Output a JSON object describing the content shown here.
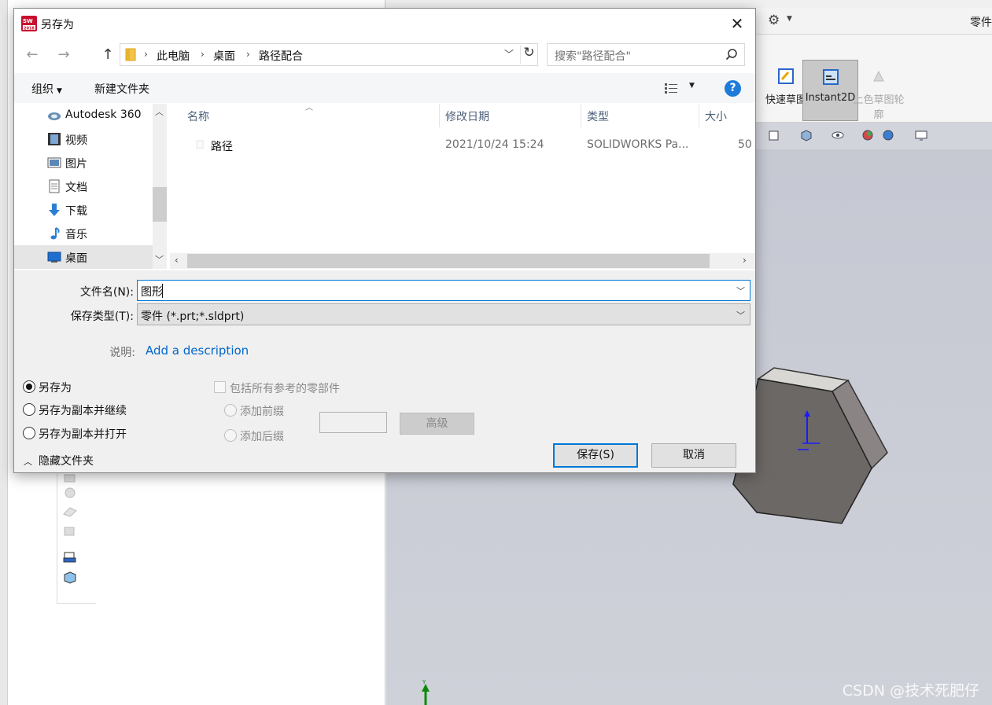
{
  "background_app": {
    "part_label": "零件",
    "ribbon": {
      "quick_sketch": "快速草图",
      "instant2d": "Instant2D",
      "shaded_sketch": "上色草图轮廓"
    },
    "watermark": "CSDN @技术死肥仔"
  },
  "dialog": {
    "title": "另存为",
    "address": {
      "crumbs": [
        "此电脑",
        "桌面",
        "路径配合"
      ]
    },
    "search": {
      "placeholder": "搜索\"路径配合\""
    },
    "commands": {
      "organize": "组织",
      "new_folder": "新建文件夹"
    },
    "nav_pane": {
      "items": [
        {
          "label": "Autodesk 360",
          "icon": "cloud-icon"
        },
        {
          "label": "视频",
          "icon": "video-icon"
        },
        {
          "label": "图片",
          "icon": "pictures-icon"
        },
        {
          "label": "文档",
          "icon": "documents-icon"
        },
        {
          "label": "下载",
          "icon": "download-icon"
        },
        {
          "label": "音乐",
          "icon": "music-icon"
        },
        {
          "label": "桌面",
          "icon": "desktop-icon",
          "selected": true
        }
      ]
    },
    "file_list": {
      "columns": {
        "name": "名称",
        "modified": "修改日期",
        "type": "类型",
        "size": "大小"
      },
      "rows": [
        {
          "name": "路径",
          "modified": "2021/10/24 15:24",
          "type": "SOLIDWORKS Pa...",
          "size": "50"
        }
      ]
    },
    "form": {
      "filename_label": "文件名(N):",
      "filename_value": "图形",
      "filetype_label": "保存类型(T):",
      "filetype_value": "零件 (*.prt;*.sldprt)",
      "description_label": "说明:",
      "description_link": "Add a description"
    },
    "options": {
      "save_as": "另存为",
      "save_as_copy_continue": "另存为副本并继续",
      "save_as_copy_open": "另存为副本并打开",
      "include_refs": "包括所有参考的零部件",
      "add_prefix": "添加前缀",
      "add_suffix": "添加后缀",
      "advanced": "高级",
      "selected_option": "另存为"
    },
    "footer": {
      "hide_folders": "隐藏文件夹",
      "save": "保存(S)",
      "cancel": "取消"
    }
  }
}
